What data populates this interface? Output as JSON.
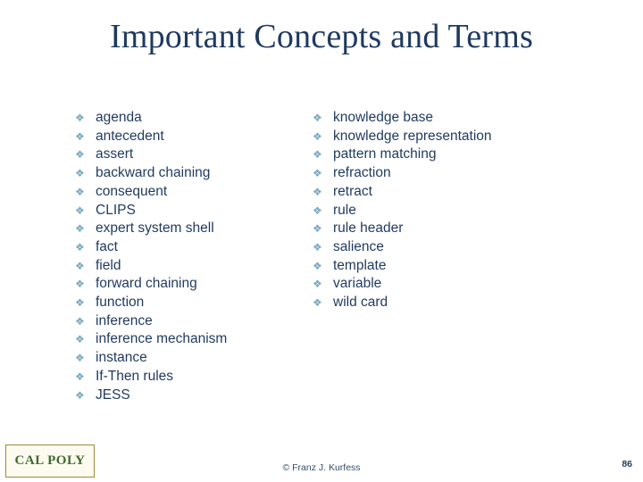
{
  "slide": {
    "title": "Important Concepts and Terms",
    "bullet_glyph": "❖",
    "left_column": [
      "agenda",
      "antecedent",
      "assert",
      "backward chaining",
      "consequent",
      "CLIPS",
      "expert system shell",
      "fact",
      "field",
      "forward chaining",
      "function",
      "inference",
      "inference mechanism",
      "instance",
      "If-Then rules",
      "JESS"
    ],
    "right_column": [
      "knowledge base",
      "knowledge representation",
      "pattern matching",
      "refraction",
      "retract",
      "rule",
      "rule header",
      "salience",
      "template",
      "variable",
      "wild card"
    ],
    "logo_text": "CAL POLY",
    "footer": "© Franz J. Kurfess",
    "page_number": "86",
    "colors": {
      "title": "#1f3a5f",
      "text": "#1f3a5f",
      "bullet": "#7aa8c4",
      "logo_border": "#9c8a3a",
      "logo_text": "#3f6b2f"
    }
  }
}
